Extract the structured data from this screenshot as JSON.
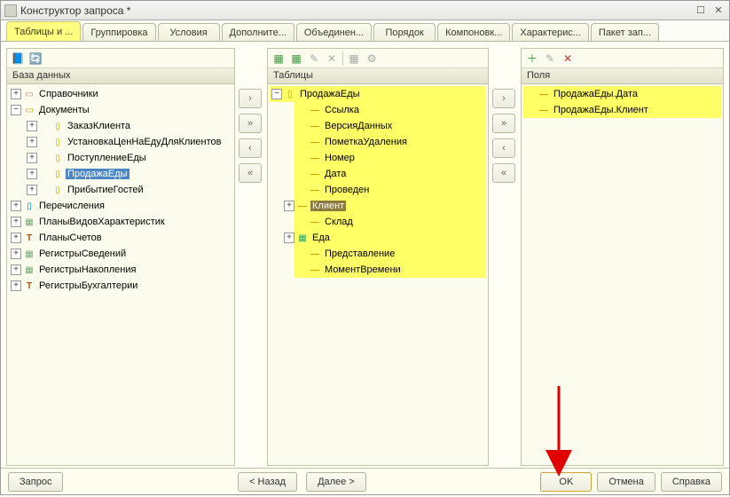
{
  "window": {
    "title": "Конструктор запроса *"
  },
  "tabs": [
    "Таблицы и ...",
    "Группировка",
    "Условия",
    "Дополните...",
    "Объединен...",
    "Порядок",
    "Компоновк...",
    "Характерис...",
    "Пакет зап..."
  ],
  "active_tab": 0,
  "panels": {
    "db": {
      "title": "База данных"
    },
    "tables": {
      "title": "Таблицы"
    },
    "fields": {
      "title": "Поля"
    }
  },
  "db_tree": {
    "root": [
      {
        "label": "Справочники",
        "icon": "book",
        "expandable": true,
        "expanded": false
      },
      {
        "label": "Документы",
        "icon": "doc",
        "expandable": true,
        "expanded": true,
        "children": [
          {
            "label": "ЗаказКлиента",
            "icon": "doc",
            "expandable": true
          },
          {
            "label": "УстановкаЦенНаЕдуДляКлиентов",
            "icon": "doc",
            "expandable": true
          },
          {
            "label": "ПоступлениеЕды",
            "icon": "doc",
            "expandable": true
          },
          {
            "label": "ПродажаЕды",
            "icon": "doc",
            "expandable": true,
            "selected": true
          },
          {
            "label": "ПрибытиеГостей",
            "icon": "doc",
            "expandable": true
          }
        ]
      },
      {
        "label": "Перечисления",
        "icon": "list",
        "expandable": true
      },
      {
        "label": "ПланыВидовХарактеристик",
        "icon": "grid",
        "expandable": true
      },
      {
        "label": "ПланыСчетов",
        "icon": "T",
        "expandable": true
      },
      {
        "label": "РегистрыСведений",
        "icon": "grid",
        "expandable": true
      },
      {
        "label": "РегистрыНакопления",
        "icon": "grid",
        "expandable": true
      },
      {
        "label": "РегистрыБухгалтерии",
        "icon": "T",
        "expandable": true
      }
    ]
  },
  "tables_tree": {
    "root": [
      {
        "label": "ПродажаЕды",
        "icon": "doc",
        "expandable": true,
        "expanded": true,
        "hl": true,
        "children": [
          {
            "label": "Ссылка",
            "icon": "dash",
            "hl": true
          },
          {
            "label": "ВерсияДанных",
            "icon": "dash",
            "hl": true
          },
          {
            "label": "ПометкаУдаления",
            "icon": "dash",
            "hl": true
          },
          {
            "label": "Номер",
            "icon": "dash",
            "hl": true
          },
          {
            "label": "Дата",
            "icon": "dash",
            "hl": true
          },
          {
            "label": "Проведен",
            "icon": "dash",
            "hl": true
          },
          {
            "label": "Клиент",
            "icon": "dash",
            "expandable": true,
            "hl": true,
            "selected_brown": true
          },
          {
            "label": "Склад",
            "icon": "dash",
            "hl": true
          },
          {
            "label": "Еда",
            "icon": "table",
            "expandable": true,
            "hl": true
          },
          {
            "label": "Представление",
            "icon": "dash",
            "hl": true
          },
          {
            "label": "МоментВремени",
            "icon": "dash",
            "hl": true
          }
        ]
      }
    ]
  },
  "fields_list": [
    {
      "label": "ПродажаЕды.Дата",
      "icon": "dash",
      "hl": true
    },
    {
      "label": "ПродажаЕды.Клиент",
      "icon": "dash",
      "hl": true
    }
  ],
  "footer": {
    "query": "Запрос",
    "back": "< Назад",
    "next": "Далее >",
    "ok": "OK",
    "cancel": "Отмена",
    "help": "Справка"
  }
}
